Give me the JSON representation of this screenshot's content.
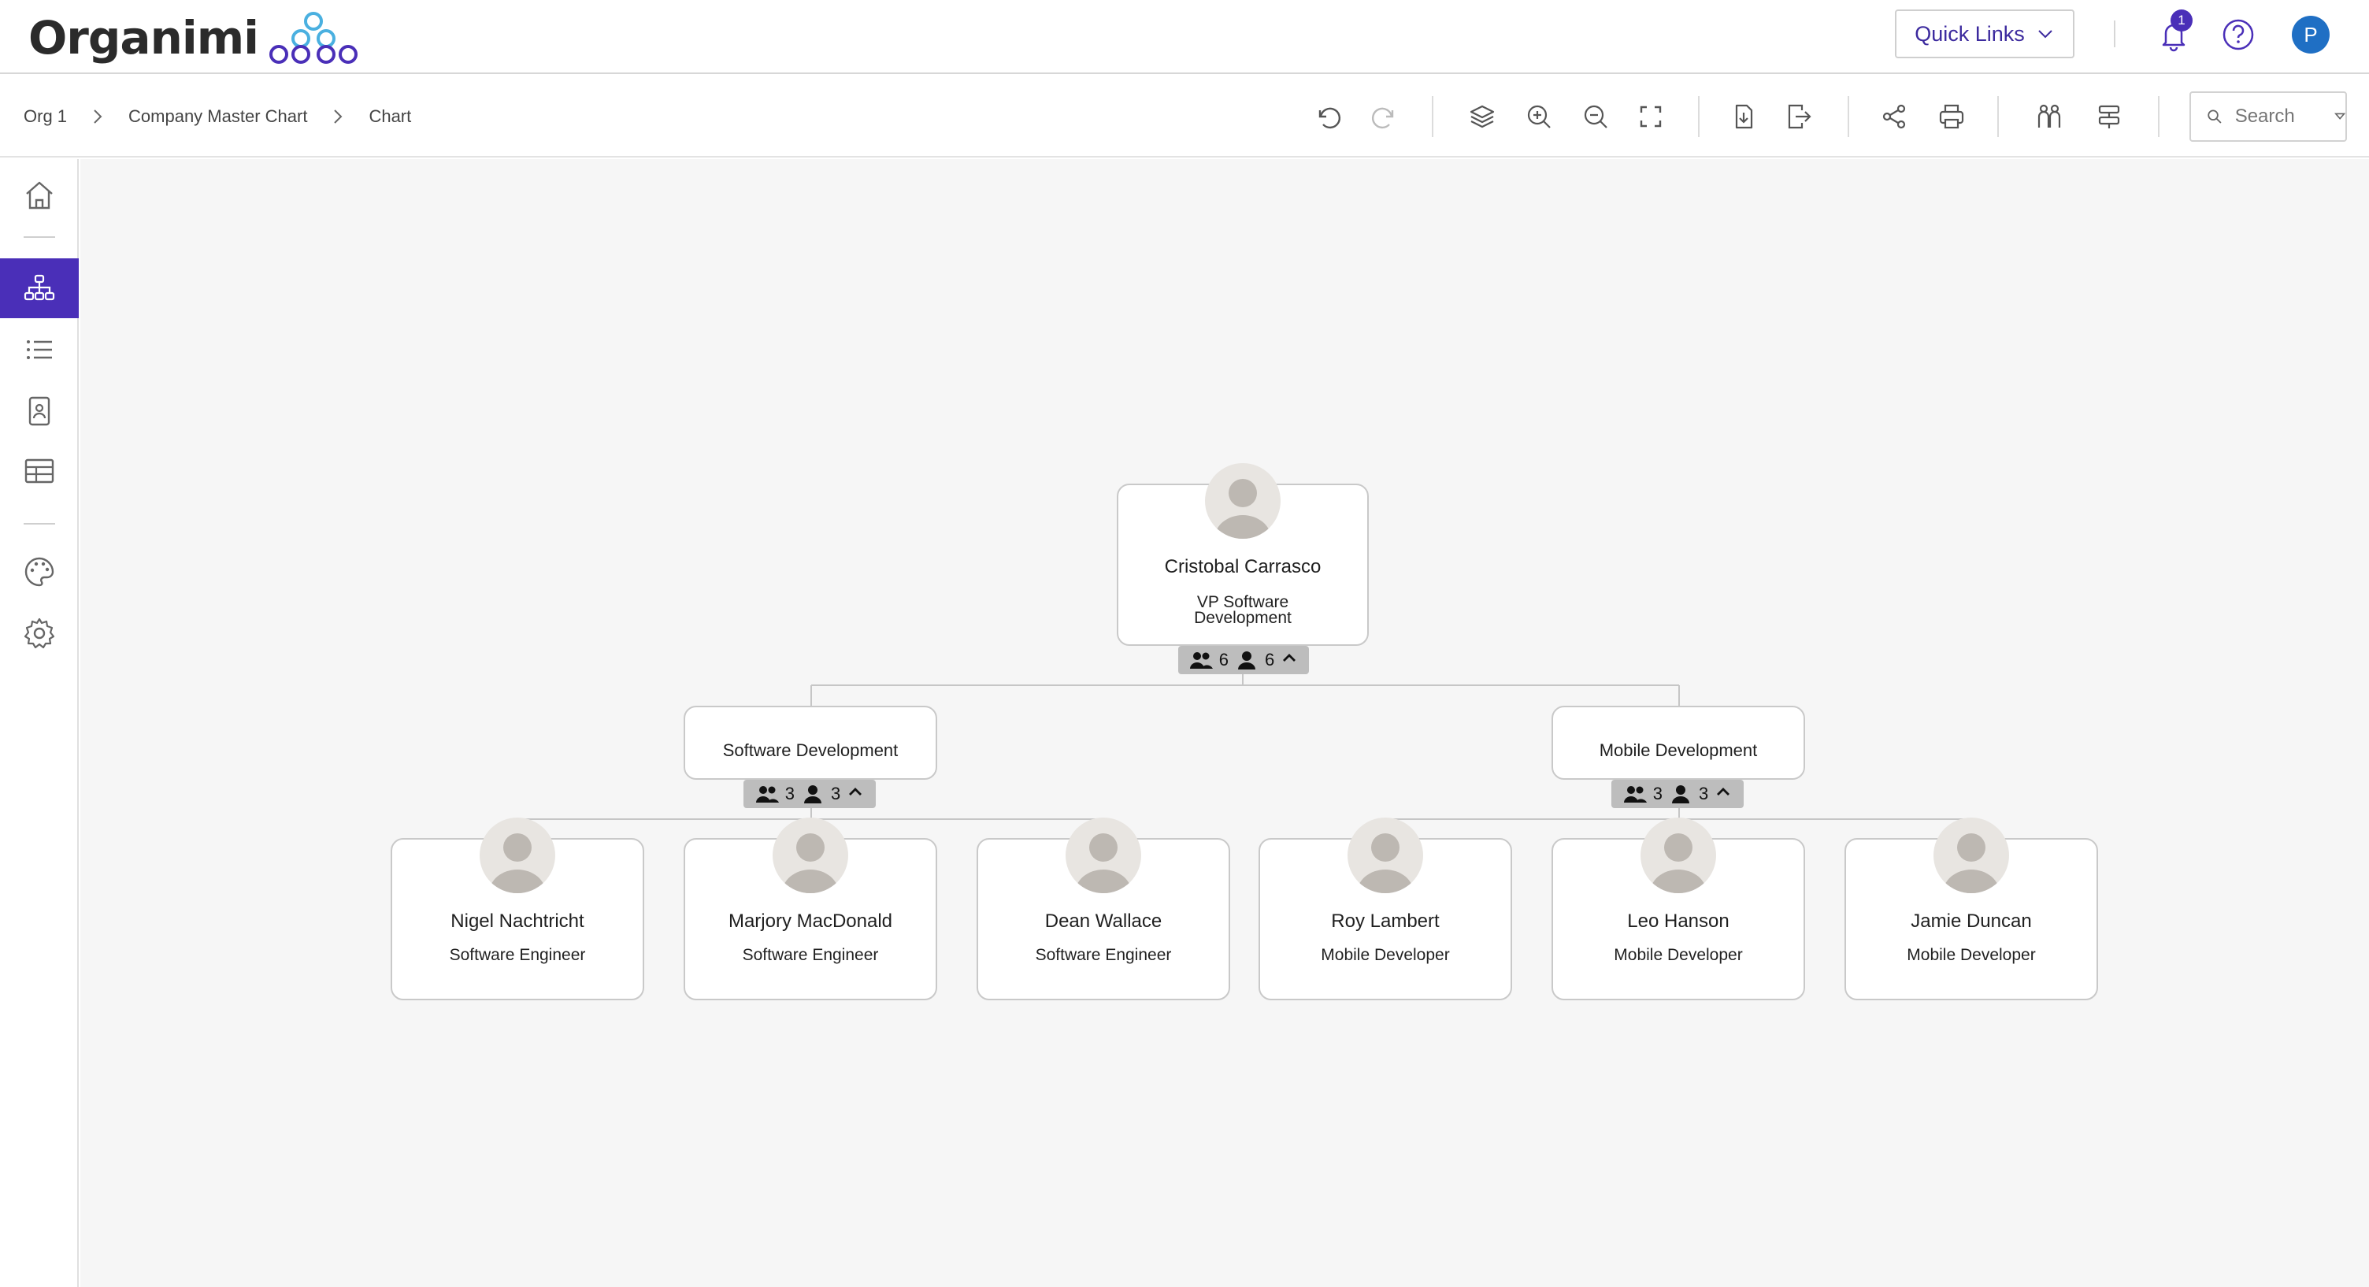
{
  "header": {
    "logo_text": "Organimi",
    "quick_links_label": "Quick Links",
    "notification_count": "1",
    "user_initial": "P"
  },
  "breadcrumb": [
    "Org 1",
    "Company Master Chart",
    "Chart"
  ],
  "search": {
    "placeholder": "Search"
  },
  "chart": {
    "root": {
      "name": "Cristobal Carrasco",
      "title_line1": "VP Software",
      "title_line2": "Development",
      "team_count": "6",
      "people_count": "6"
    },
    "departments": [
      {
        "name": "Software Development",
        "team_count": "3",
        "people_count": "3"
      },
      {
        "name": "Mobile Development",
        "team_count": "3",
        "people_count": "3"
      }
    ],
    "people": [
      {
        "name": "Nigel Nachtricht",
        "title": "Software Engineer"
      },
      {
        "name": "Marjory MacDonald",
        "title": "Software Engineer"
      },
      {
        "name": "Dean Wallace",
        "title": "Software Engineer"
      },
      {
        "name": "Roy Lambert",
        "title": "Mobile Developer"
      },
      {
        "name": "Leo Hanson",
        "title": "Mobile Developer"
      },
      {
        "name": "Jamie Duncan",
        "title": "Mobile Developer"
      }
    ]
  },
  "colors": {
    "brand": "#4a2fb8",
    "avatar": "#1f6fc4",
    "canvas": "#f6f6f6",
    "counter": "#bdbdbd"
  }
}
